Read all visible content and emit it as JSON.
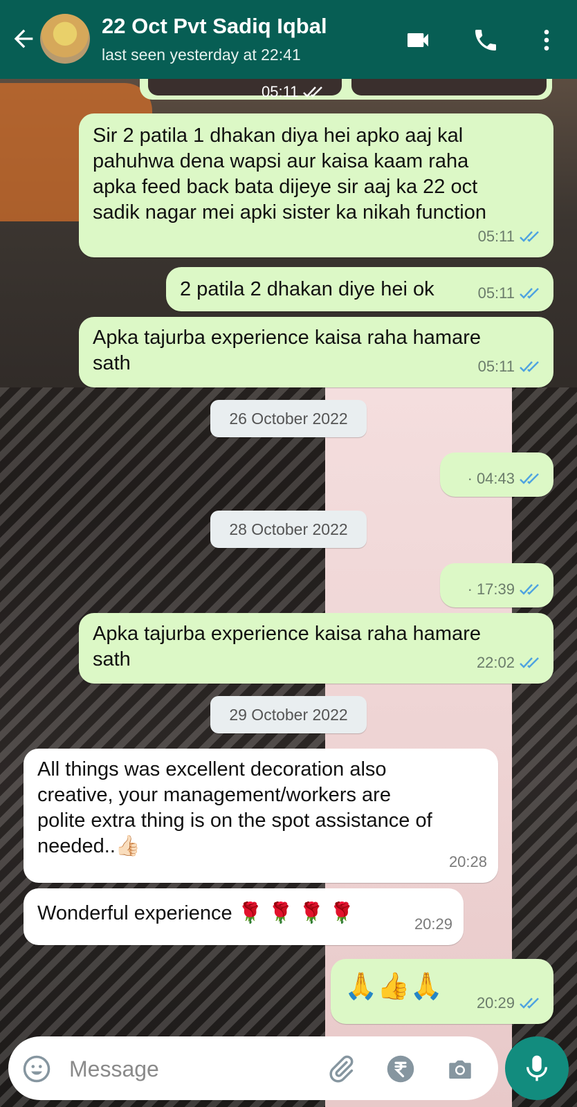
{
  "header": {
    "title": "22 Oct Pvt Sadiq Iqbal",
    "status": "last seen yesterday at 22:41"
  },
  "messages": [
    {
      "text": "",
      "time": "05:11",
      "dir": "out"
    },
    {
      "text": "Sir 2 patila 1 dhakan diya hei apko aaj kal\npahuhwa dena wapsi aur kaisa kaam raha\napka feed back bata dijeye sir aaj ka 22 oct\nsadik nagar mei apki sister ka nikah function",
      "time": "05:11",
      "dir": "out"
    },
    {
      "text": "2 patila 2 dhakan diye hei ok",
      "time": "05:11",
      "dir": "out"
    },
    {
      "text": "Apka tajurba experience kaisa raha hamare\nsath",
      "time": "05:11",
      "dir": "out"
    },
    {
      "date": "26 October 2022"
    },
    {
      "text": "·",
      "time": "04:43",
      "dir": "out"
    },
    {
      "date": "28 October 2022"
    },
    {
      "text": "·",
      "time": "17:39",
      "dir": "out"
    },
    {
      "text": "Apka tajurba experience kaisa raha hamare\nsath",
      "time": "22:02",
      "dir": "out"
    },
    {
      "date": "29 October 2022"
    },
    {
      "text": "All things was excellent decoration also\ncreative, your management/workers are\npolite extra thing is on the spot assistance of\nneeded..👍🏻",
      "time": "20:28",
      "dir": "in"
    },
    {
      "text": "Wonderful experience 🌹 🌹 🌹 🌹",
      "time": "20:29",
      "dir": "in"
    },
    {
      "text": "🙏👍🙏",
      "time": "20:29",
      "dir": "out"
    }
  ],
  "composer": {
    "placeholder": "Message"
  },
  "colors": {
    "header": "#075e54",
    "outgoing": "#dcf8c6",
    "incoming": "#ffffff",
    "ticks": "#4fa3e0",
    "mic": "#128c7e"
  },
  "icons": [
    "back-arrow-icon",
    "video-call-icon",
    "phone-icon",
    "more-vert-icon",
    "emoji-icon",
    "attach-icon",
    "rupee-icon",
    "camera-icon",
    "mic-icon",
    "read-ticks-icon"
  ]
}
